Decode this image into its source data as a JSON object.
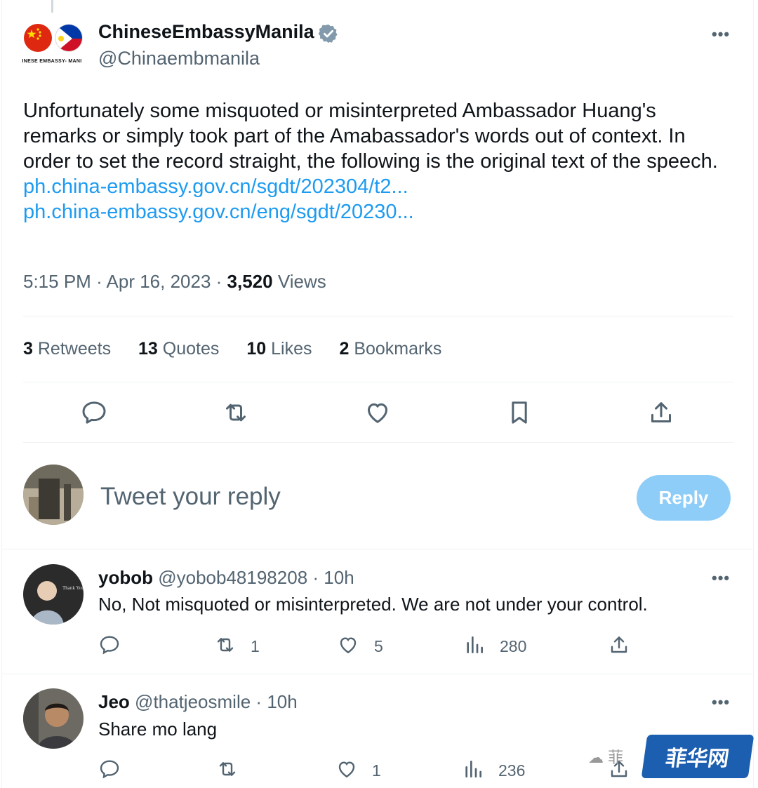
{
  "tweet": {
    "author": {
      "display_name": "ChineseEmbassyManila",
      "handle": "@Chinaembmanila",
      "avatar_caption": "INESE EMBASSY- MANI"
    },
    "text": "Unfortunately some misquoted or misinterpreted Ambassador Huang's remarks or simply took part of the Amabassador's words out of context. In order to set the record straight, the following is the original text of the speech.",
    "links": [
      "ph.china-embassy.gov.cn/sgdt/202304/t2...",
      "ph.china-embassy.gov.cn/eng/sgdt/20230..."
    ],
    "time": "5:15 PM",
    "date": "Apr 16, 2023",
    "views_count": "3,520",
    "views_label": "Views",
    "stats": [
      {
        "count": "3",
        "label": "Retweets"
      },
      {
        "count": "13",
        "label": "Quotes"
      },
      {
        "count": "10",
        "label": "Likes"
      },
      {
        "count": "2",
        "label": "Bookmarks"
      }
    ]
  },
  "compose": {
    "placeholder": "Tweet your reply",
    "button_label": "Reply"
  },
  "replies": [
    {
      "name": "yobob",
      "handle": "@yobob48198208",
      "time": "10h",
      "text": "No, Not misquoted or misinterpreted. We are  not under your control.",
      "retweets": "1",
      "likes": "5",
      "views": "280",
      "avatar_text": "Thank You"
    },
    {
      "name": "Jeo",
      "handle": "@thatjeosmile",
      "time": "10h",
      "text": "Share mo lang",
      "retweets": "",
      "likes": "1",
      "views": "236"
    }
  ],
  "watermark": {
    "text": "菲华网",
    "partial_text": "菲"
  },
  "colors": {
    "link": "#1d9bf0",
    "muted": "#536471",
    "reply_button": "#8ecdf8",
    "verified_badge": "#829aab"
  }
}
